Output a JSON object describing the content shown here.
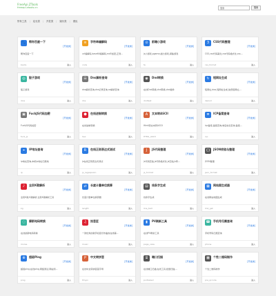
{
  "header": {
    "logo_line1": "FreeApi.ZTools",
    "logo_line2": "freeapi.ztools.cn",
    "search_placeholder": "搜索",
    "search_button": "搜索"
  },
  "nav": {
    "items": [
      "所有工具",
      "站长类",
      "开发类",
      "娱乐类",
      "便民"
    ]
  },
  "cards": [
    {
      "title": "帮你百度一下",
      "badge": "[开发类]",
      "desc": "帮你百度一下",
      "slug": "baidu",
      "enter": "进入",
      "icon": "paw-icon",
      "color": "#2a7ae2",
      "glyph": "🐾"
    },
    {
      "title": "字符串编解码",
      "badge": "[开发类]",
      "desc": "url编解码,base64编解码,md5加密,正则...",
      "slug": "code",
      "enter": "进入",
      "icon": "code-icon",
      "color": "#f0a020",
      "glyph": "≡"
    },
    {
      "title": "前端小游戏",
      "badge": "[开发类]",
      "desc": "js小游戏,pgame,魔力游戏,摸鱼游戏",
      "slug": "fe",
      "enter": "进入",
      "icon": "game-icon",
      "color": "#2a7ae2",
      "glyph": "⊙"
    },
    {
      "title": "CSS代码整理",
      "badge": "[开发类]",
      "desc": "CSS,css代码美化,css代码格式化,css...",
      "slug": "css_format",
      "enter": "进入",
      "icon": "css-icon",
      "color": "#2a7ae2",
      "glyph": "3"
    },
    {
      "title": "骰子游戏",
      "badge": "[开发类]",
      "desc": "骰子游戏",
      "slug": "dice",
      "enter": "进入",
      "icon": "dice-icon",
      "color": "#3ab6a0",
      "glyph": "◎"
    },
    {
      "title": "Dns解析查询",
      "badge": "[开发类]",
      "desc": "dns解析查询,dns记录查询,ns解析查询",
      "slug": "dns",
      "enter": "进入",
      "icon": "dns-icon",
      "color": "#777",
      "glyph": "☰"
    },
    {
      "title": "Dnd转换",
      "badge": "[开发类]",
      "desc": "在线Dnd转换,dnd转换,dnd插件",
      "slug": "dndtest",
      "enter": "进入",
      "icon": "dnd-icon",
      "color": "#555",
      "glyph": "◉"
    },
    {
      "title": "短网址生成",
      "badge": "[开发类]",
      "desc": "短网址,dwz,短网址生成,免费短网址,...",
      "slug": "dwzurl",
      "enter": "进入",
      "icon": "link-icon",
      "color": "#2a7ae2",
      "glyph": "↻"
    },
    {
      "title": "FuckJS代码加密",
      "badge": "[开发类]",
      "desc": "FuckJS代码加密",
      "slug": "fuck_js",
      "enter": "进入",
      "icon": "lock-icon",
      "color": "#777",
      "glyph": "▣"
    },
    {
      "title": "在线进制转换",
      "badge": "[开发类]",
      "desc": "在线进制转换",
      "slug": "hex",
      "enter": "进入",
      "icon": "shield-icon",
      "color": "#d23",
      "glyph": "⬢"
    },
    {
      "title": "文本转ASCII",
      "badge": "[开发类]",
      "desc": "Html转文本转ASCII",
      "slug": "HTML_ASCII",
      "enter": "进入",
      "icon": "ascii-icon",
      "color": "#d6623a",
      "glyph": "A"
    },
    {
      "title": "ICP备案查询",
      "badge": "[开发类]",
      "desc": "icp备案,备案查询,域名信息查询,备案...",
      "slug": "icp",
      "enter": "进入",
      "icon": "icp-icon",
      "color": "#2a7ae2",
      "glyph": "≣"
    },
    {
      "title": "IP地址查询",
      "badge": "[开发类]",
      "desc": "ip地址查询,本机ip地址归属地",
      "slug": "ip",
      "enter": "进入",
      "icon": "ip-icon",
      "color": "#2a7ae2",
      "glyph": "⌖"
    },
    {
      "title": "在线正则表达式测试",
      "badge": "[开发类]",
      "desc": "js在线正则表达式测试",
      "slug": "js_regexpsion",
      "enter": "进入",
      "icon": "regex-icon",
      "color": "#2a7ae2",
      "glyph": "R"
    },
    {
      "title": "JS代码整理",
      "badge": "[开发类]",
      "desc": "js代码压缩,js代码格式化,js压缩,js转...",
      "slug": "js_format",
      "enter": "进入",
      "icon": "js-icon",
      "color": "#d6623a",
      "glyph": "J"
    },
    {
      "title": "JSON校验与整理",
      "badge": "[开发类]",
      "desc": "JSON整理",
      "slug": "json_format",
      "enter": "进入",
      "icon": "json-icon",
      "color": "#555",
      "glyph": "{}"
    },
    {
      "title": "全民K歌解析",
      "badge": "[开发类]",
      "desc": "全民K歌,K歌解析,全民K歌解析工具",
      "slug": "kg",
      "enter": "进入",
      "icon": "music-icon",
      "color": "#d23",
      "glyph": "♪"
    },
    {
      "title": "长度计量单位换算",
      "badge": "[开发类]",
      "desc": "长度计量单位换算器",
      "slug": "length",
      "enter": "进入",
      "icon": "ruler-icon",
      "color": "#2a7ae2",
      "glyph": "⇄"
    },
    {
      "title": "线条字生成",
      "badge": "[开发类]",
      "desc": "线条字生成",
      "slug": "line_text",
      "enter": "进入",
      "icon": "lines-icon",
      "color": "#555",
      "glyph": "▤"
    },
    {
      "title": "网站图生成器",
      "badge": "[开发类]",
      "desc": "在线网站地图生成",
      "slug": "link_get",
      "enter": "进入",
      "icon": "sitemap-icon",
      "color": "#2a7ae2",
      "glyph": "▦"
    },
    {
      "title": "摩斯电码转换",
      "badge": "[开发类]",
      "desc": "在线摩斯电码转换",
      "slug": "morse",
      "enter": "进入",
      "icon": "morse-icon",
      "color": "#3ab6a0",
      "glyph": "◌"
    },
    {
      "title": "拾音匠",
      "badge": "[开发类]",
      "desc": "一款优秀的歌手和音乐作曲的在线辅...",
      "slug": "music",
      "enter": "进入",
      "icon": "note-icon",
      "color": "#d23",
      "glyph": "♫"
    },
    {
      "title": "PV刷新工具",
      "badge": "[开发类]",
      "desc": "在线PV刷新工具",
      "slug": "page_view",
      "enter": "进入",
      "icon": "chart-icon",
      "color": "#2a7ae2",
      "glyph": "▮"
    },
    {
      "title": "手机号归属查询",
      "badge": "[开发类]",
      "desc": "手机号码归属查询",
      "slug": "phone",
      "enter": "进入",
      "icon": "phone-icon",
      "color": "#3ab6a0",
      "glyph": "☎"
    },
    {
      "title": "超级Ping",
      "badge": "[开发类]",
      "desc": "超级ping,在线ping,网络测试,网站测...",
      "slug": "ping",
      "enter": "进入",
      "icon": "ping-icon",
      "color": "#2a7ae2",
      "glyph": "⊕"
    },
    {
      "title": "中文转拼音",
      "badge": "[开发类]",
      "desc": "在线中文转拼音首字母",
      "slug": "Pinyin",
      "enter": "进入",
      "icon": "pinyin-icon",
      "color": "#d6623a",
      "glyph": "P"
    },
    {
      "title": "端口扫描",
      "badge": "[开发类]",
      "desc": "在线端口扫描,在线工具,批量扫描,...",
      "slug": "portlabad",
      "enter": "进入",
      "icon": "port-icon",
      "color": "#555",
      "glyph": "⌸"
    },
    {
      "title": "个性二维码制作",
      "badge": "[开发类]",
      "desc": "个性二维码制作",
      "slug": "pre_qrcode",
      "enter": "进入",
      "icon": "qrcode-icon",
      "color": "#555",
      "glyph": "▩"
    }
  ]
}
